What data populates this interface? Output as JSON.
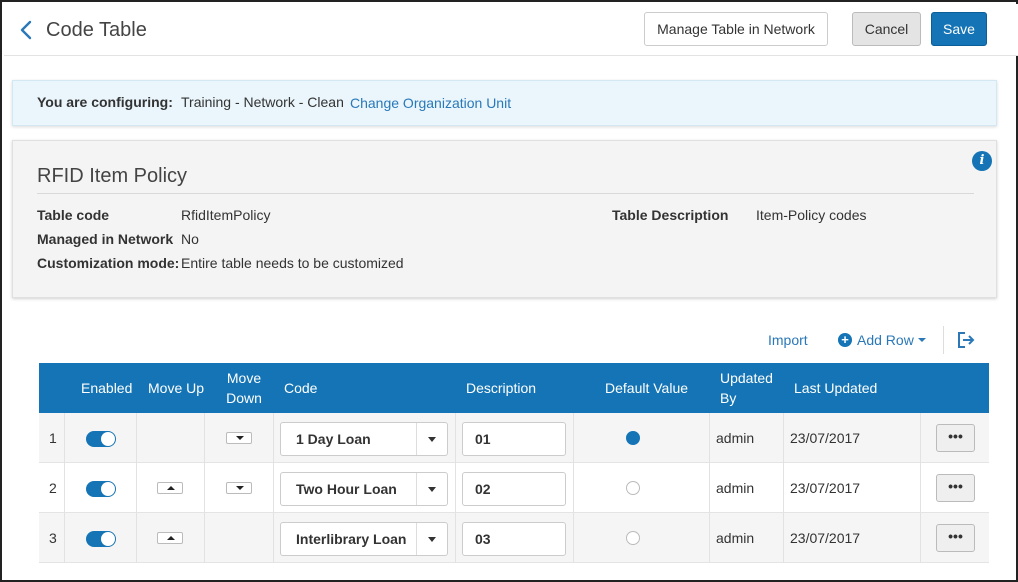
{
  "header": {
    "title": "Code Table",
    "back_icon": "chevron-left-icon",
    "manage_label": "Manage Table in Network",
    "cancel_label": "Cancel",
    "save_label": "Save"
  },
  "config": {
    "label": "You are configuring:",
    "value": "Training - Network - Clean",
    "link": "Change Organization Unit"
  },
  "panel": {
    "title": "RFID Item Policy",
    "info_icon": "i",
    "fields": {
      "table_code_label": "Table code",
      "table_code_value": "RfidItemPolicy",
      "managed_label": "Managed in Network",
      "managed_value": "No",
      "customization_label": "Customization mode:",
      "customization_value": "Entire table needs to be customized",
      "description_label": "Table Description",
      "description_value": "Item-Policy codes"
    }
  },
  "toolbar": {
    "import_label": "Import",
    "add_row_label": "Add Row",
    "export_icon": "export-icon"
  },
  "table": {
    "headers": {
      "enabled": "Enabled",
      "move_up": "Move Up",
      "move_down_1": "Move",
      "move_down_2": "Down",
      "code": "Code",
      "description": "Description",
      "default_value": "Default Value",
      "updated_by_1": "Updated",
      "updated_by_2": "By",
      "last_updated": "Last Updated"
    },
    "rows": [
      {
        "num": "1",
        "enabled": true,
        "code": "1 Day Loan",
        "description": "01",
        "default": true,
        "updated_by": "admin",
        "last_updated": "23/07/2017",
        "more": "•••"
      },
      {
        "num": "2",
        "enabled": true,
        "code": "Two Hour Loan",
        "description": "02",
        "default": false,
        "updated_by": "admin",
        "last_updated": "23/07/2017",
        "more": "•••"
      },
      {
        "num": "3",
        "enabled": true,
        "code": "Interlibrary Loan",
        "description": "03",
        "default": false,
        "updated_by": "admin",
        "last_updated": "23/07/2017",
        "more": "•••"
      }
    ]
  },
  "colors": {
    "accent": "#1474b5",
    "link": "#2a78b8",
    "config_bg": "#eaf6fc",
    "panel_bg": "#f4f4f4"
  }
}
